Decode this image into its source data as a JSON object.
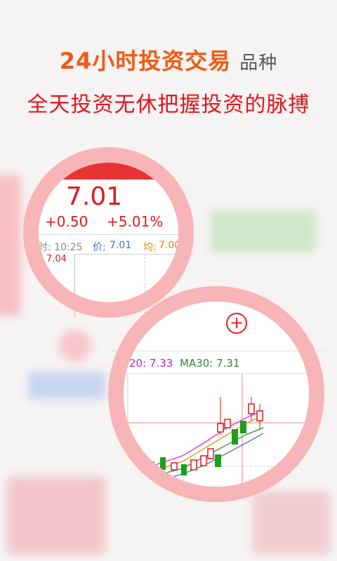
{
  "header": {
    "headline": "24小时投资交易",
    "headline_suffix": "品种",
    "subhead": "全天投资无休把握投资的脉搏"
  },
  "quote": {
    "price": "7.01",
    "change": "+0.50",
    "change_pct": "+5.01%",
    "time_label": "时: 10:25",
    "price_label": "价:",
    "price_value": "7.01",
    "avg_label": "均:",
    "avg_value": "7.00",
    "y_tick": "7.04"
  },
  "kline": {
    "add_symbol": "+",
    "ma20_label": "20: 7.33",
    "ma30_label": "MA30: 7.31"
  },
  "colors": {
    "accent": "#f05a14",
    "up": "#e01a1a",
    "down": "#1aa01a",
    "ring": "#f7b5b8"
  }
}
